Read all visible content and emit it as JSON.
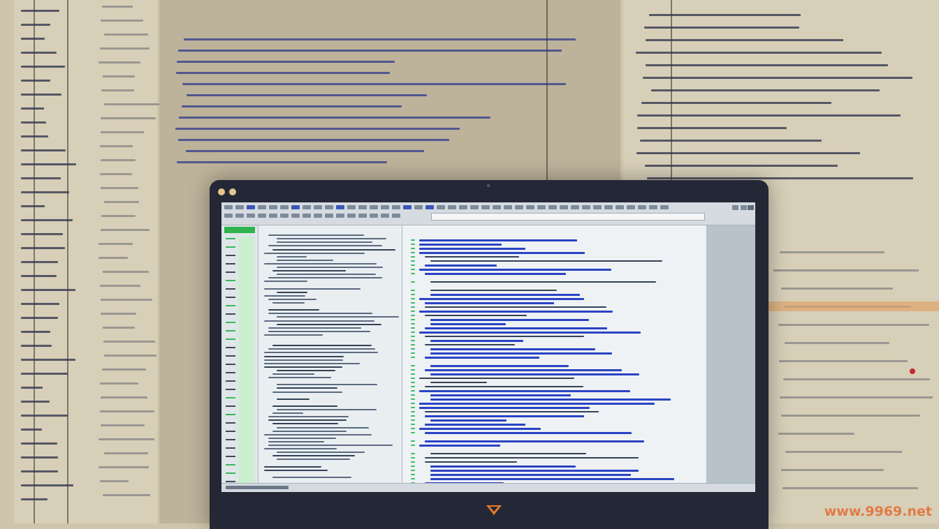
{
  "scene": {
    "window_title": "",
    "watermark": "www.9969.net"
  },
  "colors": {
    "paper_background": "#cfc5ad",
    "laptop_bezel": "#242836",
    "screen_background": "#e6ecf0",
    "code_blue": "#2a43c4",
    "gutter_green": "#2fb34e",
    "logo_orange": "#e87a2a",
    "watermark_orange": "#e2733a"
  },
  "icons": {
    "laptop_logo": "orange-chevron-logo",
    "window_dots": "traffic-light-dots"
  }
}
